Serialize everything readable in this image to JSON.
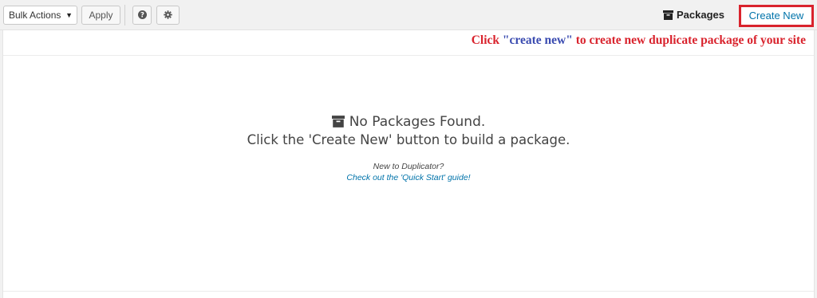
{
  "toolbar": {
    "bulk_actions_label": "Bulk Actions",
    "apply_label": "Apply",
    "help_icon": "question-circle-icon",
    "settings_icon": "gear-icon",
    "packages_label": "Packages",
    "packages_icon": "archive-box-icon",
    "create_new_label": "Create New"
  },
  "annotation": {
    "prefix": "Click ",
    "highlight": "\"create new\"",
    "suffix": " to create new duplicate package of your site",
    "color": "#d9232d",
    "highlight_color": "#3a4bb0"
  },
  "empty_state": {
    "icon": "archive-box-icon",
    "title": "No Packages Found.",
    "subtitle": "Click the 'Create New' button to build a package.",
    "new_to_text": "New to Duplicator?",
    "quick_start_link": "Check out the 'Quick Start' guide!"
  },
  "colors": {
    "link": "#0073aa",
    "highlight_border": "#d9232d"
  }
}
